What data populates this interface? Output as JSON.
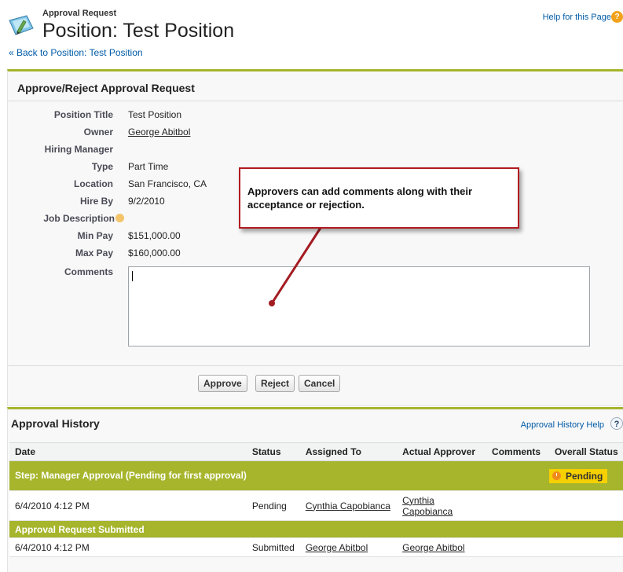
{
  "header": {
    "subtitle": "Approval Request",
    "title": "Position: Test Position",
    "back_link": "« Back to Position: Test Position",
    "help_link": "Help for this Page"
  },
  "approve_panel": {
    "title": "Approve/Reject Approval Request",
    "fields": {
      "position_title": {
        "label": "Position Title",
        "value": "Test Position"
      },
      "owner": {
        "label": "Owner",
        "value": "George Abitbol"
      },
      "hiring_manager": {
        "label": "Hiring Manager",
        "value": ""
      },
      "type": {
        "label": "Type",
        "value": "Part Time"
      },
      "location": {
        "label": "Location",
        "value": "San Francisco, CA"
      },
      "hire_by": {
        "label": "Hire By",
        "value": "9/2/2010"
      },
      "job_description": {
        "label": "Job Description",
        "value": ""
      },
      "min_pay": {
        "label": "Min Pay",
        "value": "$151,000.00"
      },
      "max_pay": {
        "label": "Max Pay",
        "value": "$160,000.00"
      },
      "comments": {
        "label": "Comments",
        "value": ""
      }
    },
    "buttons": {
      "approve": "Approve",
      "reject": "Reject",
      "cancel": "Cancel"
    }
  },
  "callout": {
    "text": "Approvers can add comments along with their acceptance or rejection."
  },
  "history": {
    "title": "Approval History",
    "help_link": "Approval History Help",
    "columns": [
      "Date",
      "Status",
      "Assigned To",
      "Actual Approver",
      "Comments",
      "Overall Status"
    ],
    "step1": {
      "label": "Step: Manager Approval (Pending for first approval)",
      "overall_status": "Pending"
    },
    "row1": {
      "date": "6/4/2010 4:12 PM",
      "status": "Pending",
      "assigned_to": "Cynthia Capobianca",
      "actual_approver": "Cynthia Capobianca",
      "comments": ""
    },
    "step2": {
      "label": "Approval Request Submitted"
    },
    "row2": {
      "date": "6/4/2010 4:12 PM",
      "status": "Submitted",
      "assigned_to": "George Abitbol",
      "actual_approver": "George Abitbol",
      "comments": ""
    }
  },
  "colors": {
    "accent_green": "#a6b52c",
    "link_blue": "#015ba7",
    "callout_red": "#b11c21",
    "pending_yellow": "#f6d000"
  },
  "icons": {
    "header": "approval-document-icon",
    "help": "help-icon",
    "pending": "clock-icon"
  }
}
